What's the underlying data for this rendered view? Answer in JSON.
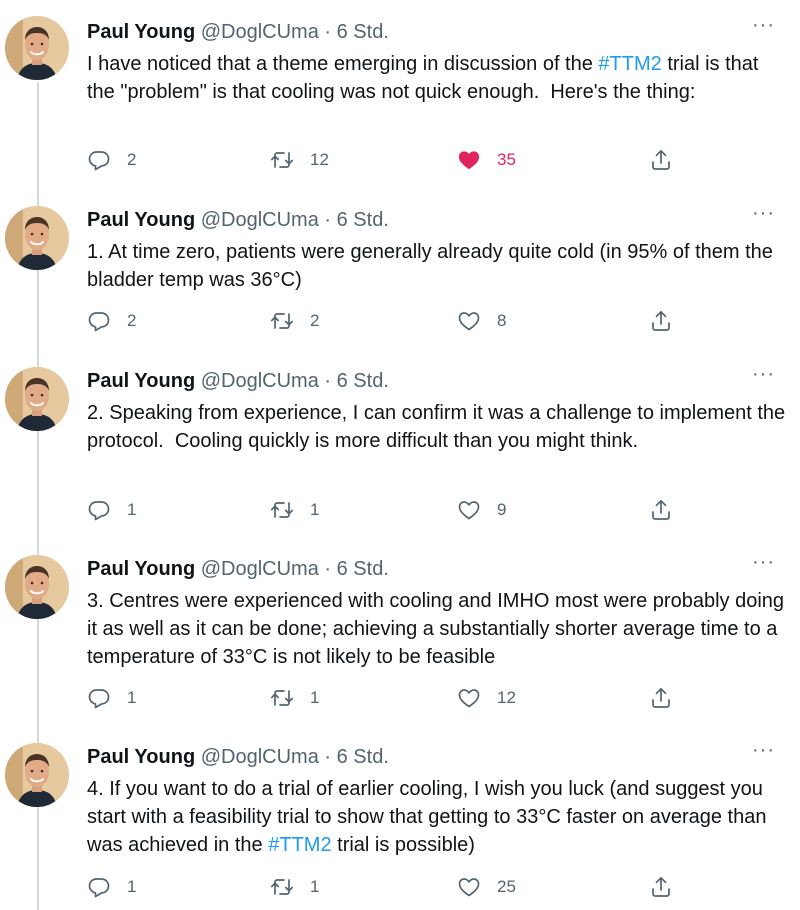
{
  "tweets": [
    {
      "name": "Paul Young",
      "handle": "@DoglCUma",
      "sep": "·",
      "time": "6 Std.",
      "more": "···",
      "text_parts": [
        "I have noticed that a theme emerging in discussion of the ",
        "#TTM2",
        " trial is that the \"problem\" is that cooling was not quick enough.  Here's the thing:"
      ],
      "replies": "2",
      "retweets": "12",
      "likes": "35",
      "liked": true
    },
    {
      "name": "Paul Young",
      "handle": "@DoglCUma",
      "sep": "·",
      "time": "6 Std.",
      "more": "···",
      "text_parts": [
        "1. At time zero, patients were generally already quite cold (in 95% of them the bladder temp was 36°C)"
      ],
      "replies": "2",
      "retweets": "2",
      "likes": "8",
      "liked": false
    },
    {
      "name": "Paul Young",
      "handle": "@DoglCUma",
      "sep": "·",
      "time": "6 Std.",
      "more": "···",
      "text_parts": [
        "2. Speaking from experience, I can confirm it was a challenge to implement the protocol.  Cooling quickly is more difficult than you might think."
      ],
      "replies": "1",
      "retweets": "1",
      "likes": "9",
      "liked": false
    },
    {
      "name": "Paul Young",
      "handle": "@DoglCUma",
      "sep": "·",
      "time": "6 Std.",
      "more": "···",
      "text_parts": [
        "3. Centres were experienced with cooling and IMHO most were probably doing it as well as it can be done; achieving a substantially shorter average time to a temperature of 33°C is not likely to be feasible"
      ],
      "replies": "1",
      "retweets": "1",
      "likes": "12",
      "liked": false
    },
    {
      "name": "Paul Young",
      "handle": "@DoglCUma",
      "sep": "·",
      "time": "6 Std.",
      "more": "···",
      "text_parts": [
        "4. If you want to do a trial of earlier cooling, I wish you luck (and suggest you start with a feasibility trial to show that getting to 33°C faster on average than was achieved in the ",
        "#TTM2",
        " trial is possible)"
      ],
      "replies": "1",
      "retweets": "1",
      "likes": "25",
      "liked": false
    }
  ],
  "colors": {
    "link": "#1d9bf0",
    "like_active": "#e0245e",
    "muted": "#536471",
    "thread_line": "#cfd9de"
  },
  "icons": {
    "reply": "reply-icon",
    "retweet": "retweet-icon",
    "like": "heart-icon",
    "share": "share-icon",
    "more": "more-icon"
  }
}
